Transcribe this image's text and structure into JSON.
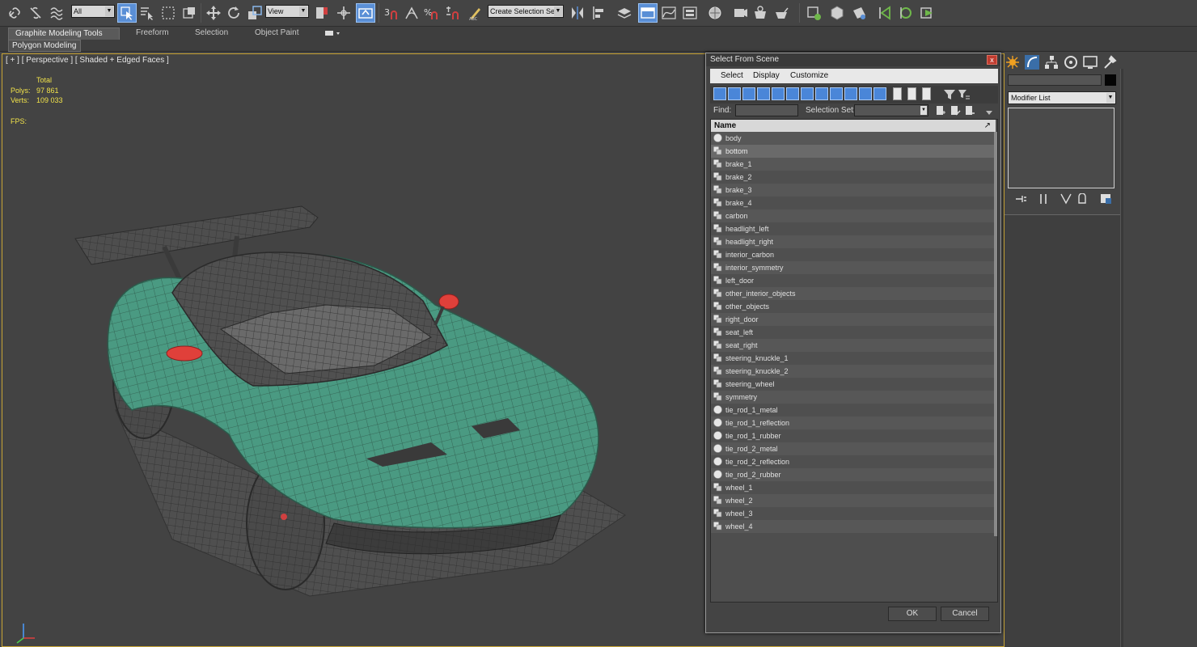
{
  "toolbar": {
    "selection_filter": "All",
    "ref_coord": "View",
    "named_selection_placeholder": "Create Selection Se"
  },
  "ribbon": {
    "tabs": [
      "Graphite Modeling Tools",
      "Freeform",
      "Selection",
      "Object Paint"
    ],
    "sub_tab": "Polygon Modeling"
  },
  "viewport": {
    "label": "[ + ] [ Perspective ] [ Shaded + Edged Faces ]",
    "stats": {
      "total_label": "Total",
      "polys_label": "Polys:",
      "polys_value": "97 861",
      "verts_label": "Verts:",
      "verts_value": "109 033",
      "fps_label": "FPS:"
    }
  },
  "dialog": {
    "title": "Select From Scene",
    "close": "x",
    "menu": [
      "Select",
      "Display",
      "Customize"
    ],
    "find_label": "Find:",
    "selection_set_label": "Selection Set:",
    "column_name": "Name",
    "ok": "OK",
    "cancel": "Cancel",
    "items": [
      {
        "name": "body",
        "icon": "sphere-icon"
      },
      {
        "name": "bottom",
        "icon": "group-icon",
        "selected": true
      },
      {
        "name": "brake_1",
        "icon": "group-icon"
      },
      {
        "name": "brake_2",
        "icon": "group-icon"
      },
      {
        "name": "brake_3",
        "icon": "group-icon"
      },
      {
        "name": "brake_4",
        "icon": "group-icon"
      },
      {
        "name": "carbon",
        "icon": "group-icon"
      },
      {
        "name": "headlight_left",
        "icon": "group-icon"
      },
      {
        "name": "headlight_right",
        "icon": "group-icon"
      },
      {
        "name": "interior_carbon",
        "icon": "group-icon"
      },
      {
        "name": "interior_symmetry",
        "icon": "group-icon"
      },
      {
        "name": "left_door",
        "icon": "group-icon"
      },
      {
        "name": "other_interior_objects",
        "icon": "group-icon"
      },
      {
        "name": "other_objects",
        "icon": "group-icon"
      },
      {
        "name": "right_door",
        "icon": "group-icon"
      },
      {
        "name": "seat_left",
        "icon": "group-icon"
      },
      {
        "name": "seat_right",
        "icon": "group-icon"
      },
      {
        "name": "steering_knuckle_1",
        "icon": "group-icon"
      },
      {
        "name": "steering_knuckle_2",
        "icon": "group-icon"
      },
      {
        "name": "steering_wheel",
        "icon": "group-icon"
      },
      {
        "name": "symmetry",
        "icon": "group-icon"
      },
      {
        "name": "tie_rod_1_metal",
        "icon": "sphere-icon"
      },
      {
        "name": "tie_rod_1_reflection",
        "icon": "sphere-icon"
      },
      {
        "name": "tie_rod_1_rubber",
        "icon": "sphere-icon"
      },
      {
        "name": "tie_rod_2_metal",
        "icon": "sphere-icon"
      },
      {
        "name": "tie_rod_2_reflection",
        "icon": "sphere-icon"
      },
      {
        "name": "tie_rod_2_rubber",
        "icon": "sphere-icon"
      },
      {
        "name": "wheel_1",
        "icon": "group-icon"
      },
      {
        "name": "wheel_2",
        "icon": "group-icon"
      },
      {
        "name": "wheel_3",
        "icon": "group-icon"
      },
      {
        "name": "wheel_4",
        "icon": "group-icon"
      }
    ]
  },
  "command_panel": {
    "modifier_list": "Modifier List"
  },
  "colors": {
    "car_body": "#4a9a82",
    "mirror_red": "#e0403a",
    "viewport_border": "#c8a435",
    "stats_text": "#f1e24a",
    "active_blue": "#5a8fd6"
  }
}
